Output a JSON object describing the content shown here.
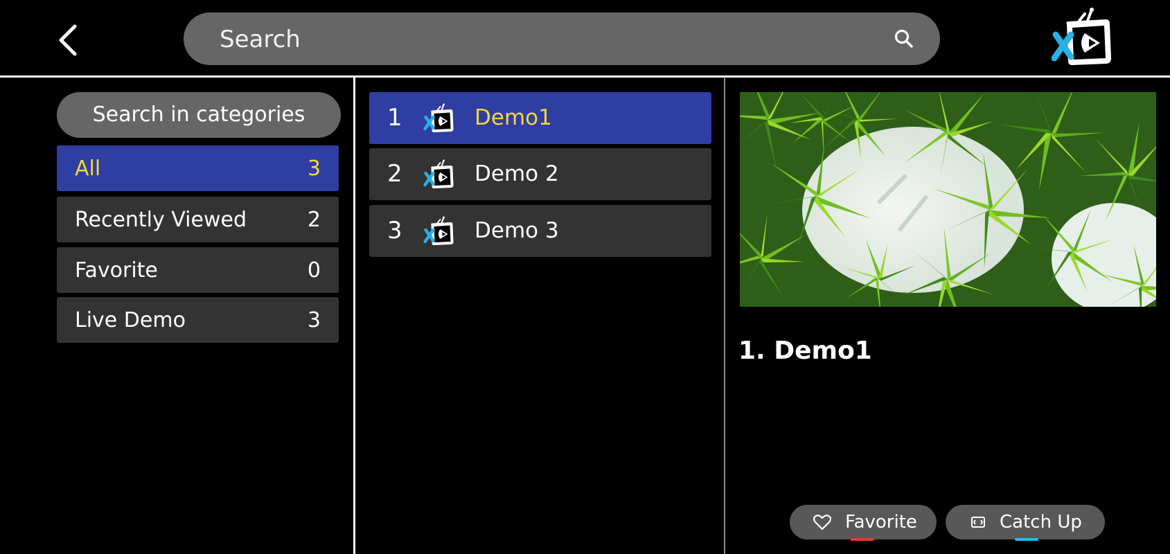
{
  "header": {
    "search_placeholder": "Search",
    "back_icon": "chevron-left-icon",
    "search_icon": "magnifier-icon",
    "logo_icon": "xc-tv-logo"
  },
  "categories": {
    "search_label": "Search in categories",
    "items": [
      {
        "label": "All",
        "count": "3",
        "active": true
      },
      {
        "label": "Recently Viewed",
        "count": "2",
        "active": false
      },
      {
        "label": "Favorite",
        "count": "0",
        "active": false
      },
      {
        "label": "Live Demo",
        "count": "3",
        "active": false
      }
    ]
  },
  "channels": {
    "items": [
      {
        "number": "1",
        "name": "Demo1",
        "active": true
      },
      {
        "number": "2",
        "name": "Demo 2",
        "active": false
      },
      {
        "number": "3",
        "name": "Demo 3",
        "active": false
      }
    ]
  },
  "detail": {
    "title": "1.  Demo1",
    "favorite_label": "Favorite",
    "catchup_label": "Catch Up",
    "colors": {
      "accent_yellow": "#f5d63a",
      "selection_blue": "#2f3ea3",
      "favorite_underline": "#e53935",
      "catchup_underline": "#29b6f6"
    }
  }
}
